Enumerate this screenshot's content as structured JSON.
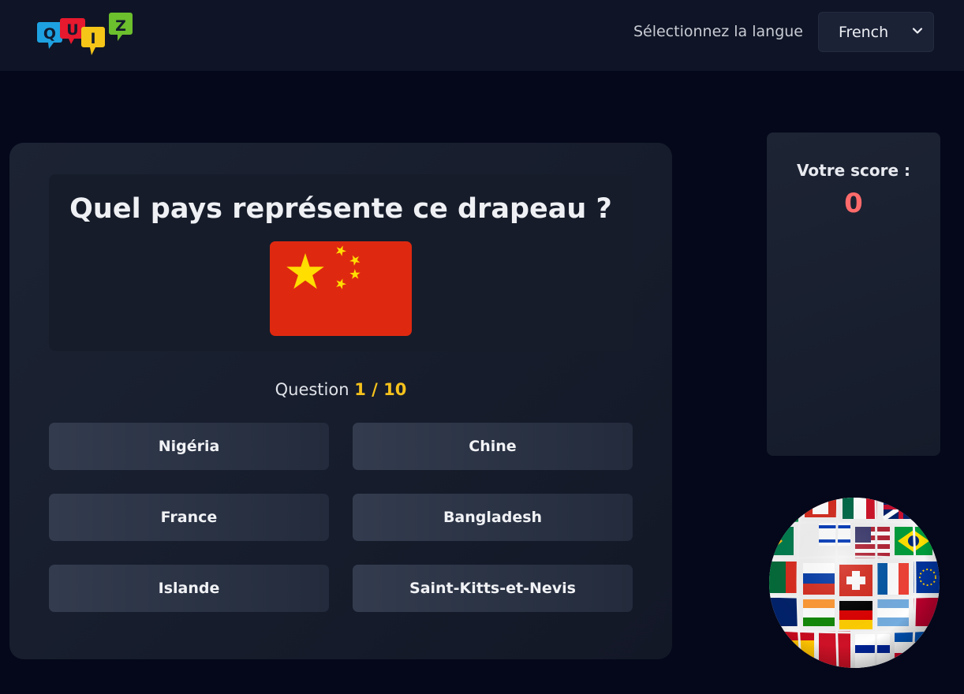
{
  "header": {
    "logo": {
      "letters": [
        "Q",
        "U",
        "I",
        "Z"
      ],
      "colors": [
        "#1ea1e0",
        "#e6192e",
        "#f5c518",
        "#6cbf2d"
      ]
    },
    "language_label": "Sélectionnez la langue",
    "language_select": {
      "selected": "French",
      "icon": "chevron-down-icon"
    }
  },
  "quiz": {
    "question": "Quel pays représente ce drapeau ?",
    "flag": {
      "country_icon": "china-flag",
      "colors": {
        "field": "#de2910",
        "stars": "#ffde00"
      }
    },
    "progress": {
      "label": "Question",
      "value": "1 / 10",
      "current": 1,
      "total": 10
    },
    "answers": [
      {
        "label": "Nigéria"
      },
      {
        "label": "Chine"
      },
      {
        "label": "France"
      },
      {
        "label": "Bangladesh"
      },
      {
        "label": "Islande"
      },
      {
        "label": "Saint-Kitts-et-Nevis"
      }
    ]
  },
  "score": {
    "label": "Votre score :",
    "value": "0"
  },
  "decoration": {
    "globe_icon": "flags-globe-icon"
  },
  "colors": {
    "background": "#04081a",
    "topbar": "#0f1526",
    "accent_yellow": "#f6c21c",
    "score_red": "#ff6b6b"
  }
}
